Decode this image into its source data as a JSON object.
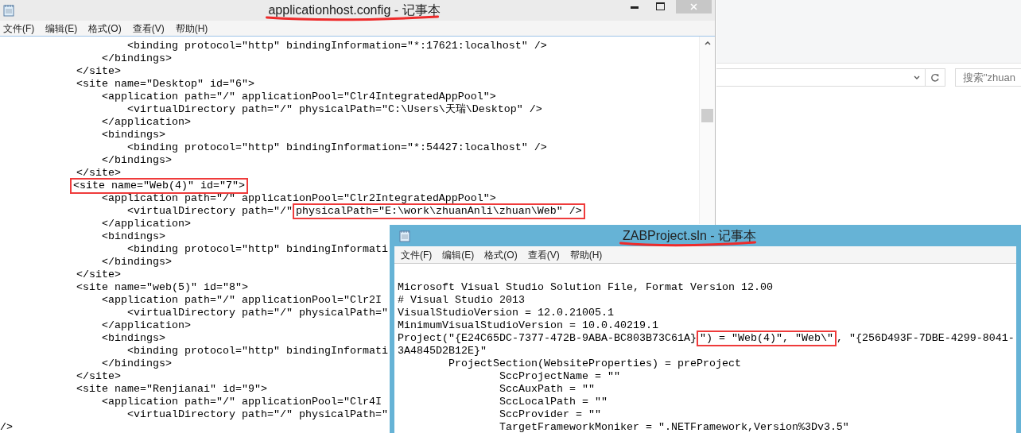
{
  "config_window": {
    "title": "applicationhost.config - 记事本",
    "title_underlined": true,
    "menu": [
      "文件(F)",
      "编辑(E)",
      "格式(O)",
      "查看(V)",
      "帮助(H)"
    ],
    "lines": [
      {
        "segments": [
          {
            "text": "                    <binding protocol=\"http\" bindingInformation=\"*:17621:localhost\" />",
            "highlighted": false
          }
        ]
      },
      {
        "segments": [
          {
            "text": "                </bindings>",
            "highlighted": false
          }
        ]
      },
      {
        "segments": [
          {
            "text": "            </site>",
            "highlighted": false
          }
        ]
      },
      {
        "segments": [
          {
            "text": "            <site name=\"Desktop\" id=\"6\">",
            "highlighted": false
          }
        ]
      },
      {
        "segments": [
          {
            "text": "                <application path=\"/\" applicationPool=\"Clr4IntegratedAppPool\">",
            "highlighted": false
          }
        ]
      },
      {
        "segments": [
          {
            "text": "                    <virtualDirectory path=\"/\" physicalPath=\"C:\\Users\\天瑞\\Desktop\" />",
            "highlighted": false
          }
        ]
      },
      {
        "segments": [
          {
            "text": "                </application>",
            "highlighted": false
          }
        ]
      },
      {
        "segments": [
          {
            "text": "                <bindings>",
            "highlighted": false
          }
        ]
      },
      {
        "segments": [
          {
            "text": "                    <binding protocol=\"http\" bindingInformation=\"*:54427:localhost\" />",
            "highlighted": false
          }
        ]
      },
      {
        "segments": [
          {
            "text": "                </bindings>",
            "highlighted": false
          }
        ]
      },
      {
        "segments": [
          {
            "text": "            </site>",
            "highlighted": false
          }
        ]
      },
      {
        "segments": [
          {
            "text": "           <site name=\"Web(4)\" id=\"7\">",
            "highlighted": true
          }
        ]
      },
      {
        "segments": [
          {
            "text": "                <application path=\"/\" applicationPool=\"Clr2IntegratedAppPool\">",
            "highlighted": false
          }
        ]
      },
      {
        "segments": [
          {
            "text": "                    <virtualDirectory path=\"/\"",
            "highlighted": false
          },
          {
            "text": "physicalPath=\"E:\\work\\zhuanAnli\\zhuan\\Web\" />",
            "highlighted": true
          }
        ]
      },
      {
        "segments": [
          {
            "text": "                </application>",
            "highlighted": false
          }
        ]
      },
      {
        "segments": [
          {
            "text": "                <bindings>",
            "highlighted": false
          }
        ]
      },
      {
        "segments": [
          {
            "text": "                    <binding protocol=\"http\" bindingInformati",
            "highlighted": false
          }
        ]
      },
      {
        "segments": [
          {
            "text": "                </bindings>",
            "highlighted": false
          }
        ]
      },
      {
        "segments": [
          {
            "text": "            </site>",
            "highlighted": false
          }
        ]
      },
      {
        "segments": [
          {
            "text": "            <site name=\"web(5)\" id=\"8\">",
            "highlighted": false
          }
        ]
      },
      {
        "segments": [
          {
            "text": "                <application path=\"/\" applicationPool=\"Clr2I",
            "highlighted": false
          }
        ]
      },
      {
        "segments": [
          {
            "text": "                    <virtualDirectory path=\"/\" physicalPath=\"",
            "highlighted": false
          }
        ]
      },
      {
        "segments": [
          {
            "text": "                </application>",
            "highlighted": false
          }
        ]
      },
      {
        "segments": [
          {
            "text": "                <bindings>",
            "highlighted": false
          }
        ]
      },
      {
        "segments": [
          {
            "text": "                    <binding protocol=\"http\" bindingInformati",
            "highlighted": false
          }
        ]
      },
      {
        "segments": [
          {
            "text": "                </bindings>",
            "highlighted": false
          }
        ]
      },
      {
        "segments": [
          {
            "text": "            </site>",
            "highlighted": false
          }
        ]
      },
      {
        "segments": [
          {
            "text": "            <site name=\"Renjianai\" id=\"9\">",
            "highlighted": false
          }
        ]
      },
      {
        "segments": [
          {
            "text": "                <application path=\"/\" applicationPool=\"Clr4I",
            "highlighted": false
          }
        ]
      },
      {
        "segments": [
          {
            "text": "                    <virtualDirectory path=\"/\" physicalPath=\"",
            "highlighted": false
          }
        ]
      },
      {
        "segments": [
          {
            "text": "/>",
            "highlighted": false
          }
        ]
      }
    ]
  },
  "explorer": {
    "search": {
      "placeholder": "搜索\"zhuan"
    }
  },
  "sln_window": {
    "title": "ZABProject.sln - 记事本",
    "title_underlined": true,
    "menu": [
      "文件(F)",
      "编辑(E)",
      "格式(O)",
      "查看(V)",
      "帮助(H)"
    ],
    "lines": [
      {
        "segments": [
          {
            "text": "Microsoft Visual Studio Solution File, Format Version 12.00",
            "highlighted": false
          }
        ]
      },
      {
        "segments": [
          {
            "text": "# Visual Studio 2013",
            "highlighted": false
          }
        ]
      },
      {
        "segments": [
          {
            "text": "VisualStudioVersion = 12.0.21005.1",
            "highlighted": false
          }
        ]
      },
      {
        "segments": [
          {
            "text": "MinimumVisualStudioVersion = 10.0.40219.1",
            "highlighted": false
          }
        ]
      },
      {
        "segments": [
          {
            "text": "Project(\"{E24C65DC-7377-472B-9ABA-BC803B73C61A}",
            "highlighted": false
          },
          {
            "text": "\") = \"Web(4)\", \"Web\\\"",
            "highlighted": true
          },
          {
            "text": ", \"{256D493F-7DBE-4299-8041-",
            "highlighted": false
          }
        ]
      },
      {
        "segments": [
          {
            "text": "3A4845D2B12E}\"",
            "highlighted": false
          }
        ]
      },
      {
        "segments": [
          {
            "text": "        ProjectSection(WebsiteProperties) = preProject",
            "highlighted": false
          }
        ]
      },
      {
        "segments": [
          {
            "text": "                SccProjectName = \"\"",
            "highlighted": false
          }
        ]
      },
      {
        "segments": [
          {
            "text": "                SccAuxPath = \"\"",
            "highlighted": false
          }
        ]
      },
      {
        "segments": [
          {
            "text": "                SccLocalPath = \"\"",
            "highlighted": false
          }
        ]
      },
      {
        "segments": [
          {
            "text": "                SccProvider = \"\"",
            "highlighted": false
          }
        ]
      },
      {
        "segments": [
          {
            "text": "                TargetFrameworkMoniker = \".NETFramework,Version%3Dv3.5\"",
            "highlighted": false
          }
        ]
      }
    ]
  }
}
